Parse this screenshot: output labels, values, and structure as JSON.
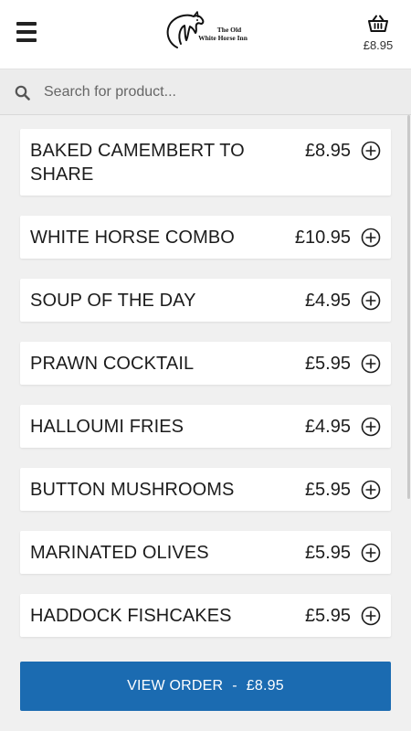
{
  "header": {
    "logo_line1": "The Old",
    "logo_line2": "White Horse Inn",
    "basket_total": "£8.95"
  },
  "search": {
    "placeholder": "Search for product..."
  },
  "menu_items": [
    {
      "name": "BAKED CAMEMBERT TO SHARE",
      "price": "£8.95"
    },
    {
      "name": "WHITE HORSE COMBO",
      "price": "£10.95"
    },
    {
      "name": "SOUP OF THE DAY",
      "price": "£4.95"
    },
    {
      "name": "PRAWN COCKTAIL",
      "price": "£5.95"
    },
    {
      "name": "HALLOUMI FRIES",
      "price": "£4.95"
    },
    {
      "name": "BUTTON MUSHROOMS",
      "price": "£5.95"
    },
    {
      "name": "MARINATED OLIVES",
      "price": "£5.95"
    },
    {
      "name": "HADDOCK FISHCAKES",
      "price": "£5.95"
    }
  ],
  "footer": {
    "view_order_label": "VIEW ORDER",
    "separator": "-",
    "order_total": "£8.95"
  },
  "colors": {
    "accent": "#1b6bb1",
    "background": "#f0f0f0"
  },
  "icons": [
    "hamburger-menu-icon",
    "horse-logo-icon",
    "basket-icon",
    "search-icon",
    "plus-circle-icon"
  ]
}
